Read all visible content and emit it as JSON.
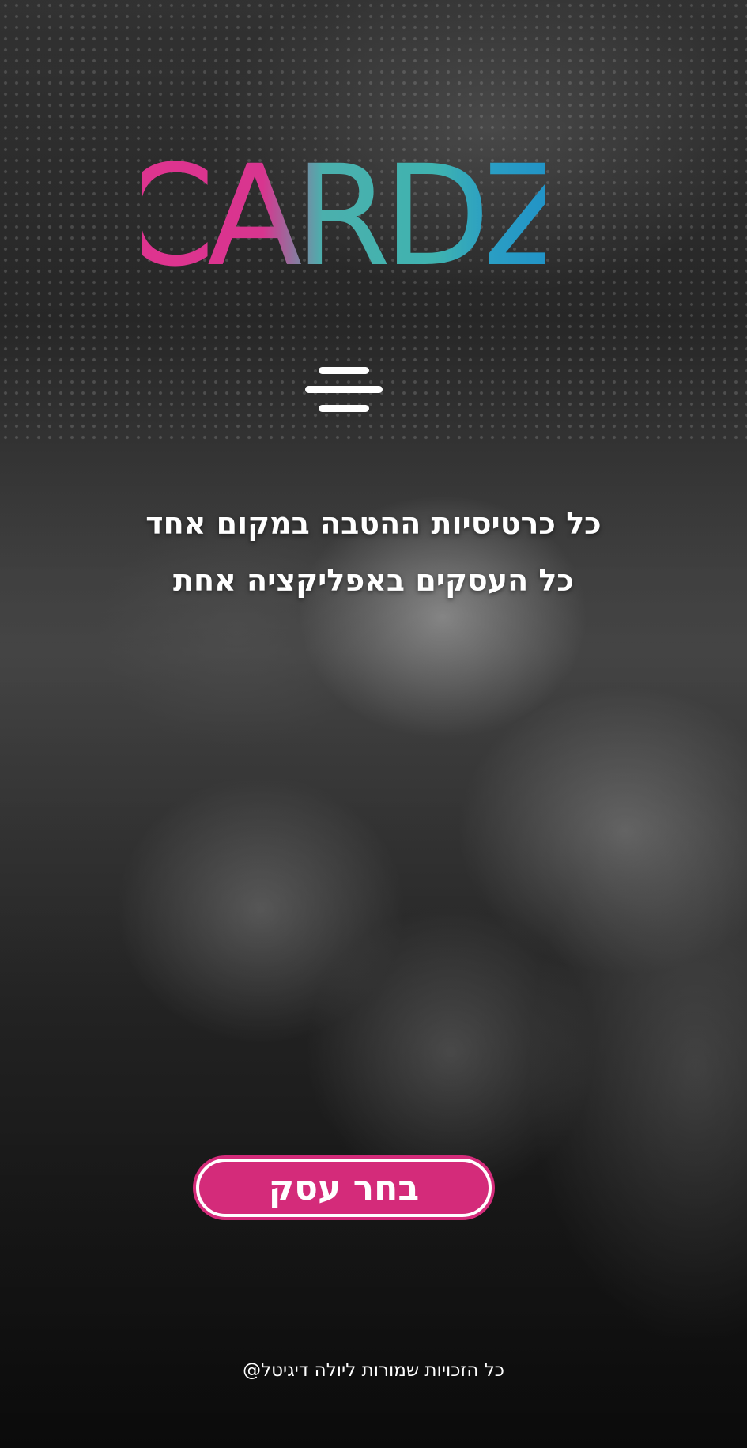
{
  "logo": {
    "text": "CARDZ",
    "colors": {
      "pink": "#e0338f",
      "teal": "#3fb3b0",
      "blue": "#1e8fc8"
    }
  },
  "menu": {
    "icon": "hamburger-menu-icon"
  },
  "tagline": {
    "line1": "כל כרטיסיות ההטבה במקום אחד",
    "line2": "כל העסקים באפליקציה אחת"
  },
  "cta": {
    "label": "בחר עסק",
    "color": "#d42b7a"
  },
  "footer": {
    "copyright": "כל הזכויות שמורות ליולה דיגיטל@"
  }
}
